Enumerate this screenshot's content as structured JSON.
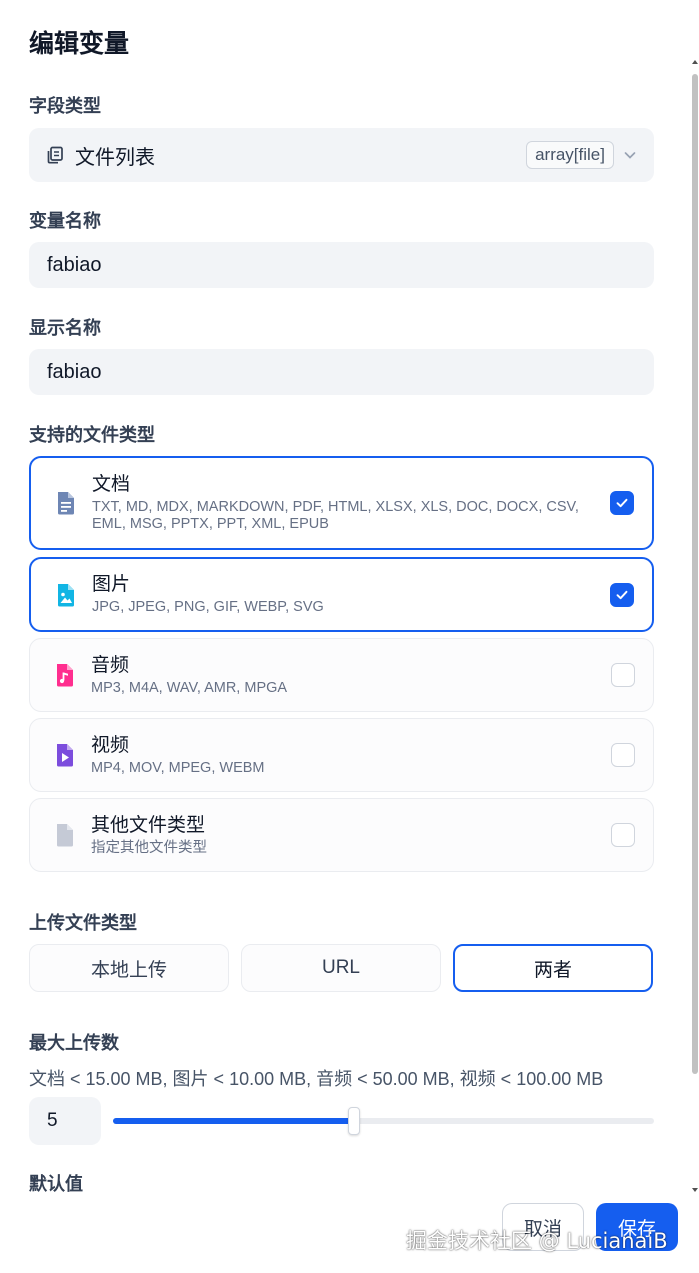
{
  "title": "编辑变量",
  "field_type": {
    "label": "字段类型",
    "value": "文件列表",
    "badge": "array[file]"
  },
  "variable_name": {
    "label": "变量名称",
    "value": "fabiao"
  },
  "display_name": {
    "label": "显示名称",
    "value": "fabiao"
  },
  "supported_types": {
    "label": "支持的文件类型",
    "items": [
      {
        "name": "文档",
        "desc": "TXT, MD, MDX, MARKDOWN, PDF, HTML, XLSX, XLS, DOC, DOCX, CSV, EML, MSG, PPTX, PPT, XML, EPUB",
        "checked": true,
        "icon": "document-icon",
        "color": "#6e86b4"
      },
      {
        "name": "图片",
        "desc": "JPG, JPEG, PNG, GIF, WEBP, SVG",
        "checked": true,
        "icon": "image-icon",
        "color": "#11b5e4"
      },
      {
        "name": "音频",
        "desc": "MP3, M4A, WAV, AMR, MPGA",
        "checked": false,
        "icon": "audio-icon",
        "color": "#ff2e8f"
      },
      {
        "name": "视频",
        "desc": "MP4, MOV, MPEG, WEBM",
        "checked": false,
        "icon": "video-icon",
        "color": "#7c4ddd"
      },
      {
        "name": "其他文件类型",
        "desc": "指定其他文件类型",
        "checked": false,
        "icon": "file-icon",
        "color": "#c5cad6"
      }
    ]
  },
  "upload_method": {
    "label": "上传文件类型",
    "options": [
      "本地上传",
      "URL",
      "两者"
    ],
    "selected": "两者"
  },
  "max_uploads": {
    "label": "最大上传数",
    "limits": "文档 < 15.00 MB, 图片 < 10.00 MB, 音频 < 50.00 MB, 视频 < 100.00 MB",
    "value": "5",
    "slider_fraction": 0.445
  },
  "default_value": {
    "label": "默认值"
  },
  "actions": {
    "cancel": "取消",
    "save": "保存"
  },
  "watermark": "掘金技术社区 @ LucianaiB",
  "colors": {
    "accent": "#155eef"
  }
}
